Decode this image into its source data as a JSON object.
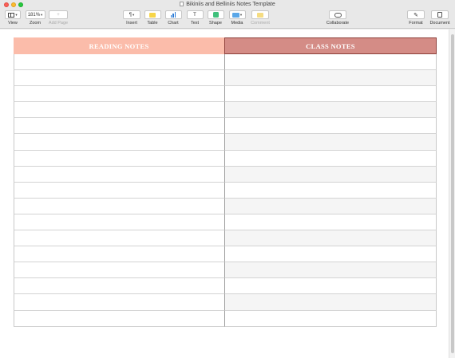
{
  "window": {
    "title": "Bikiniis and Belliniis Notes Template"
  },
  "toolbar": {
    "view_label": "View",
    "zoom_value": "181%",
    "zoom_label": "Zoom",
    "add_page_label": "Add Page",
    "insert_label": "Insert",
    "insert_glyph": "¶",
    "table_label": "Table",
    "chart_label": "Chart",
    "text_label": "Text",
    "text_glyph": "T",
    "shape_label": "Shape",
    "media_label": "Media",
    "comment_label": "Comment",
    "collaborate_label": "Collaborate",
    "format_label": "Format",
    "document_label": "Document"
  },
  "table": {
    "left_header": "READING NOTES",
    "right_header": "CLASS NOTES",
    "left_header_color": "#fbbcaa",
    "right_header_color": "#d48c86",
    "right_header_border": "#8c3f3a",
    "row_count": 17
  },
  "icons": [
    "view-icon",
    "add-page-icon",
    "paragraph-icon",
    "table-icon",
    "chart-icon",
    "text-icon",
    "shape-icon",
    "media-icon",
    "comment-icon",
    "collaborate-icon",
    "format-brush-icon",
    "document-icon"
  ]
}
